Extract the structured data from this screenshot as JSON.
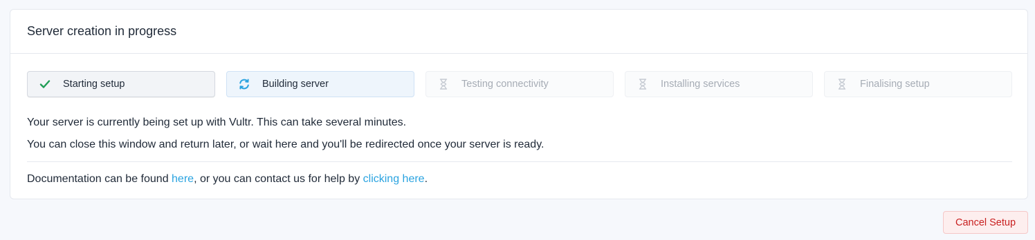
{
  "header": {
    "title": "Server creation in progress"
  },
  "steps": [
    {
      "label": "Starting setup",
      "status": "done",
      "icon": "check-icon"
    },
    {
      "label": "Building server",
      "status": "active",
      "icon": "refresh-icon"
    },
    {
      "label": "Testing connectivity",
      "status": "pending",
      "icon": "hourglass-icon"
    },
    {
      "label": "Installing services",
      "status": "pending",
      "icon": "hourglass-icon"
    },
    {
      "label": "Finalising setup",
      "status": "pending",
      "icon": "hourglass-icon"
    }
  ],
  "message": {
    "line1": "Your server is currently being set up with Vultr. This can take several minutes.",
    "line2": "You can close this window and return later, or wait here and you'll be redirected once your server is ready."
  },
  "docs": {
    "prefix": "Documentation can be found ",
    "link1": "here",
    "middle": ", or you can contact us for help by ",
    "link2": "clicking here",
    "suffix": "."
  },
  "actions": {
    "cancel_label": "Cancel Setup"
  },
  "colors": {
    "accent": "#2aa3e0",
    "success": "#1f9d55",
    "danger": "#c81e1e",
    "pending": "#c5cad2"
  }
}
